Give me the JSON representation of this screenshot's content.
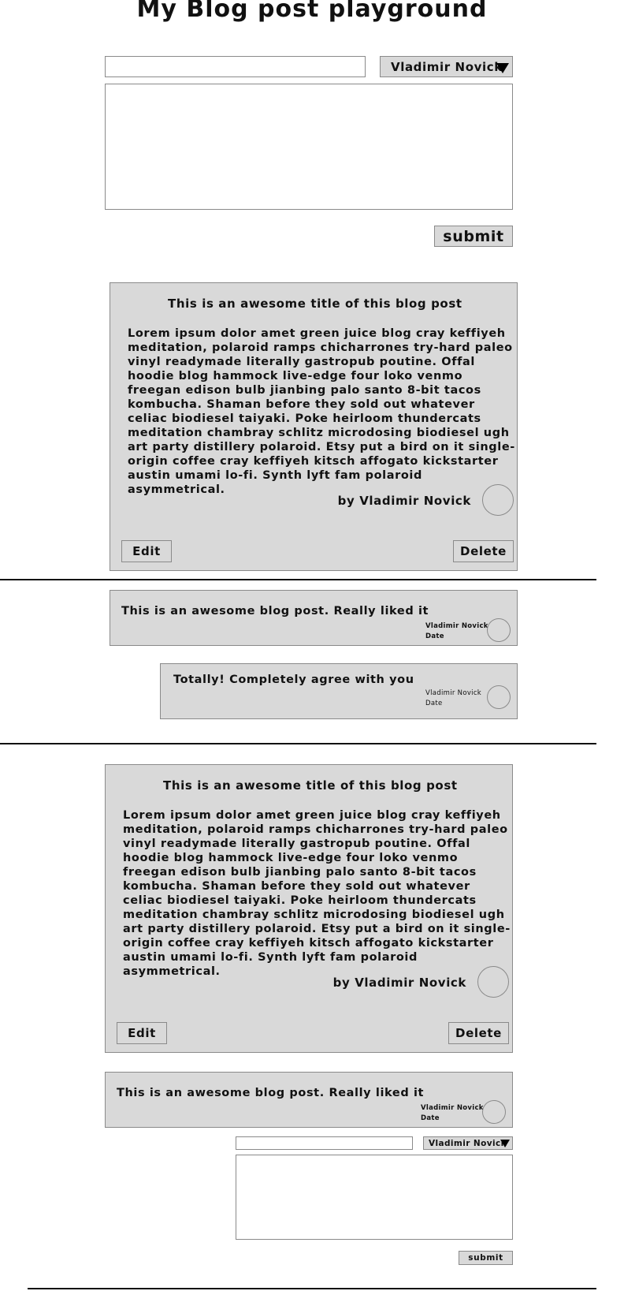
{
  "page": {
    "title": "My Blog post playground"
  },
  "new_post_form": {
    "title_value": "",
    "author_select": "Vladimir Novick",
    "body_value": "",
    "submit_label": "submit"
  },
  "posts": [
    {
      "title": "This is an awesome title of this blog post",
      "body": "Lorem ipsum dolor amet green juice blog cray keffiyeh meditation, polaroid ramps chicharrones try-hard paleo vinyl readymade literally gastropub poutine. Offal hoodie blog hammock live-edge four loko venmo freegan edison bulb jianbing palo santo 8-bit tacos kombucha. Shaman before they sold out whatever celiac biodiesel taiyaki. Poke heirloom thundercats meditation chambray schlitz microdosing biodiesel ugh art party distillery polaroid. Etsy put a bird on it single-origin coffee cray keffiyeh kitsch affogato kickstarter austin umami lo-fi. Synth lyft fam polaroid asymmetrical.",
      "author": "by Vladimir Novick",
      "edit_label": "Edit",
      "delete_label": "Delete",
      "comments": [
        {
          "text": "This is an awesome blog post. Really liked it",
          "author": "Vladimir Novick",
          "date": "Date"
        },
        {
          "text": "Totally! Completely agree with you",
          "author": "Vladimir Novick",
          "date": "Date"
        }
      ]
    },
    {
      "title": "This is an awesome title of this blog post",
      "body": "Lorem ipsum dolor amet green juice blog cray keffiyeh meditation, polaroid ramps chicharrones try-hard paleo vinyl readymade literally gastropub poutine. Offal hoodie blog hammock live-edge four loko venmo freegan edison bulb jianbing palo santo 8-bit tacos kombucha. Shaman before they sold out whatever celiac biodiesel taiyaki. Poke heirloom thundercats meditation chambray schlitz microdosing biodiesel ugh art party distillery polaroid. Etsy put a bird on it single-origin coffee cray keffiyeh kitsch affogato kickstarter austin umami lo-fi. Synth lyft fam polaroid asymmetrical.",
      "author": "by Vladimir Novick",
      "edit_label": "Edit",
      "delete_label": "Delete",
      "comments": [
        {
          "text": "This is an awesome blog post. Really liked it",
          "author": "Vladimir Novick",
          "date": "Date"
        }
      ]
    }
  ],
  "reply_form": {
    "text_value": "",
    "author_select": "Vladimir Novick",
    "body_value": "",
    "submit_label": "submit"
  }
}
